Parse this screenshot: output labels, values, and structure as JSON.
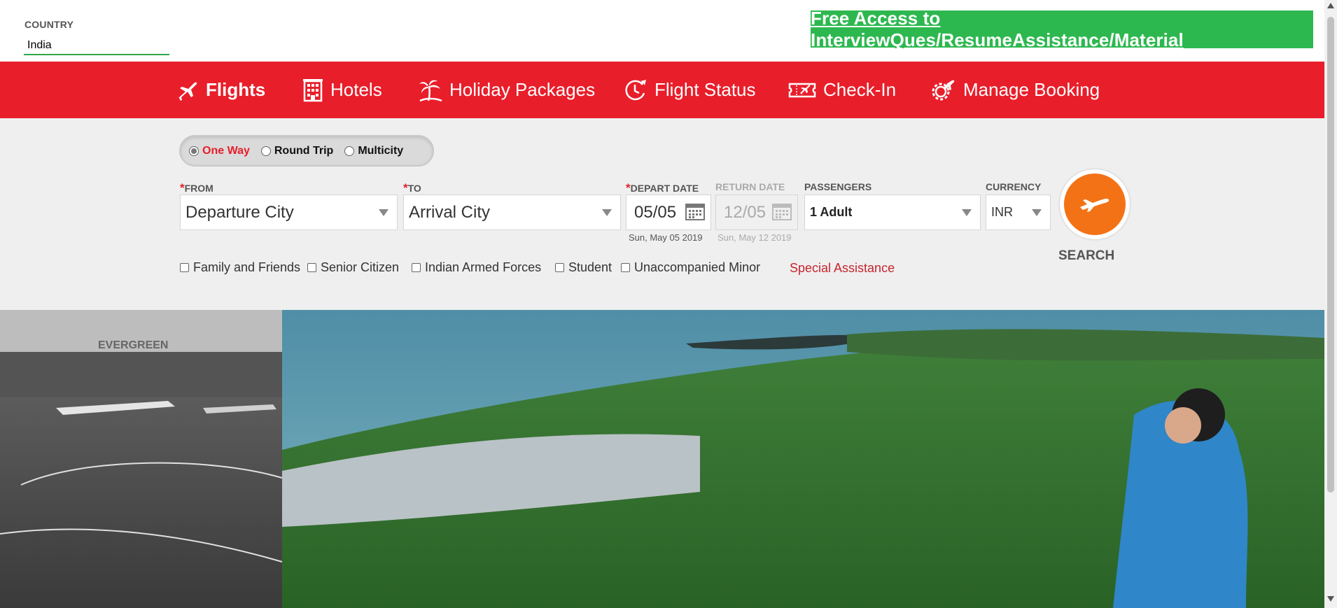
{
  "header": {
    "country_label": "COUNTRY",
    "country_value": "India",
    "promo_link": "Free Access to InterviewQues/ResumeAssistance/Material"
  },
  "nav": {
    "items": [
      {
        "label": "Flights",
        "icon": "plane-icon",
        "active": true
      },
      {
        "label": "Hotels",
        "icon": "building-icon"
      },
      {
        "label": "Holiday Packages",
        "icon": "palm-tree-icon"
      },
      {
        "label": "Flight Status",
        "icon": "clock-plane-icon"
      },
      {
        "label": "Check-In",
        "icon": "ticket-icon"
      },
      {
        "label": "Manage Booking",
        "icon": "gear-plane-icon"
      }
    ]
  },
  "trip_type": {
    "options": [
      "One Way",
      "Round Trip",
      "Multicity"
    ],
    "selected": "One Way"
  },
  "form": {
    "from_label": "FROM",
    "from_value": "Departure City",
    "to_label": "TO",
    "to_value": "Arrival City",
    "depart_label": "DEPART DATE",
    "depart_value": "05/05",
    "depart_sub": "Sun, May 05 2019",
    "return_label": "RETURN DATE",
    "return_value": "12/05",
    "return_sub": "Sun, May 12 2019",
    "passengers_label": "PASSENGERS",
    "passengers_value": "1 Adult",
    "currency_label": "CURRENCY",
    "currency_value": "INR",
    "required_mark": "*",
    "search_label": "SEARCH"
  },
  "discounts": {
    "options": [
      "Family and Friends",
      "Senior Citizen",
      "Indian Armed Forces",
      "Student",
      "Unaccompanied Minor"
    ],
    "special_assistance": "Special Assistance"
  },
  "colors": {
    "brand_red": "#e81e2a",
    "promo_green": "#2db84f",
    "search_orange": "#f47216"
  }
}
